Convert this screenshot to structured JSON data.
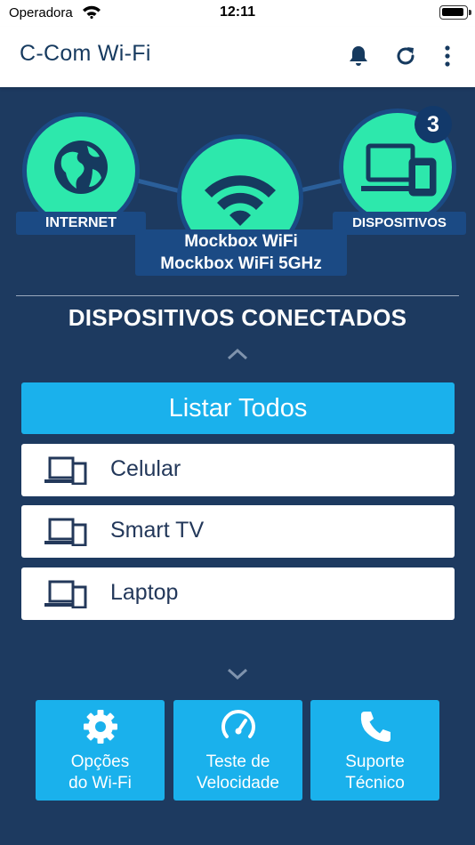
{
  "status_bar": {
    "carrier": "Operadora",
    "time": "12:11"
  },
  "app_bar": {
    "title": "C-Com Wi-Fi",
    "icons": [
      "bell-icon",
      "refresh-icon",
      "more-vertical-icon"
    ]
  },
  "network_map": {
    "internet_label": "INTERNET",
    "network_names": [
      "Mockbox WiFi",
      "Mockbox WiFi 5GHz"
    ],
    "devices_label": "DISPOSITIVOS",
    "device_count": "3",
    "icons": [
      "globe-icon",
      "wifi-icon",
      "devices-icon"
    ]
  },
  "connected": {
    "title": "DISPOSITIVOS CONECTADOS",
    "list_all_label": "Listar Todos",
    "devices": [
      {
        "name": "Celular",
        "icon": "device-icon"
      },
      {
        "name": "Smart TV",
        "icon": "device-icon"
      },
      {
        "name": "Laptop",
        "icon": "device-icon"
      }
    ]
  },
  "actions": [
    {
      "label_line1": "Opções",
      "label_line2": "do Wi-Fi",
      "icon": "gear-icon"
    },
    {
      "label_line1": "Teste de",
      "label_line2": "Velocidade",
      "icon": "speedometer-icon"
    },
    {
      "label_line1": "Suporte",
      "label_line2": "Técnico",
      "icon": "phone-icon"
    }
  ],
  "colors": {
    "background": "#1d3a60",
    "accent": "#1ab1ec",
    "node_green": "#2de8ac",
    "label_blue": "#1b4a84",
    "title_text": "#163a5f"
  }
}
